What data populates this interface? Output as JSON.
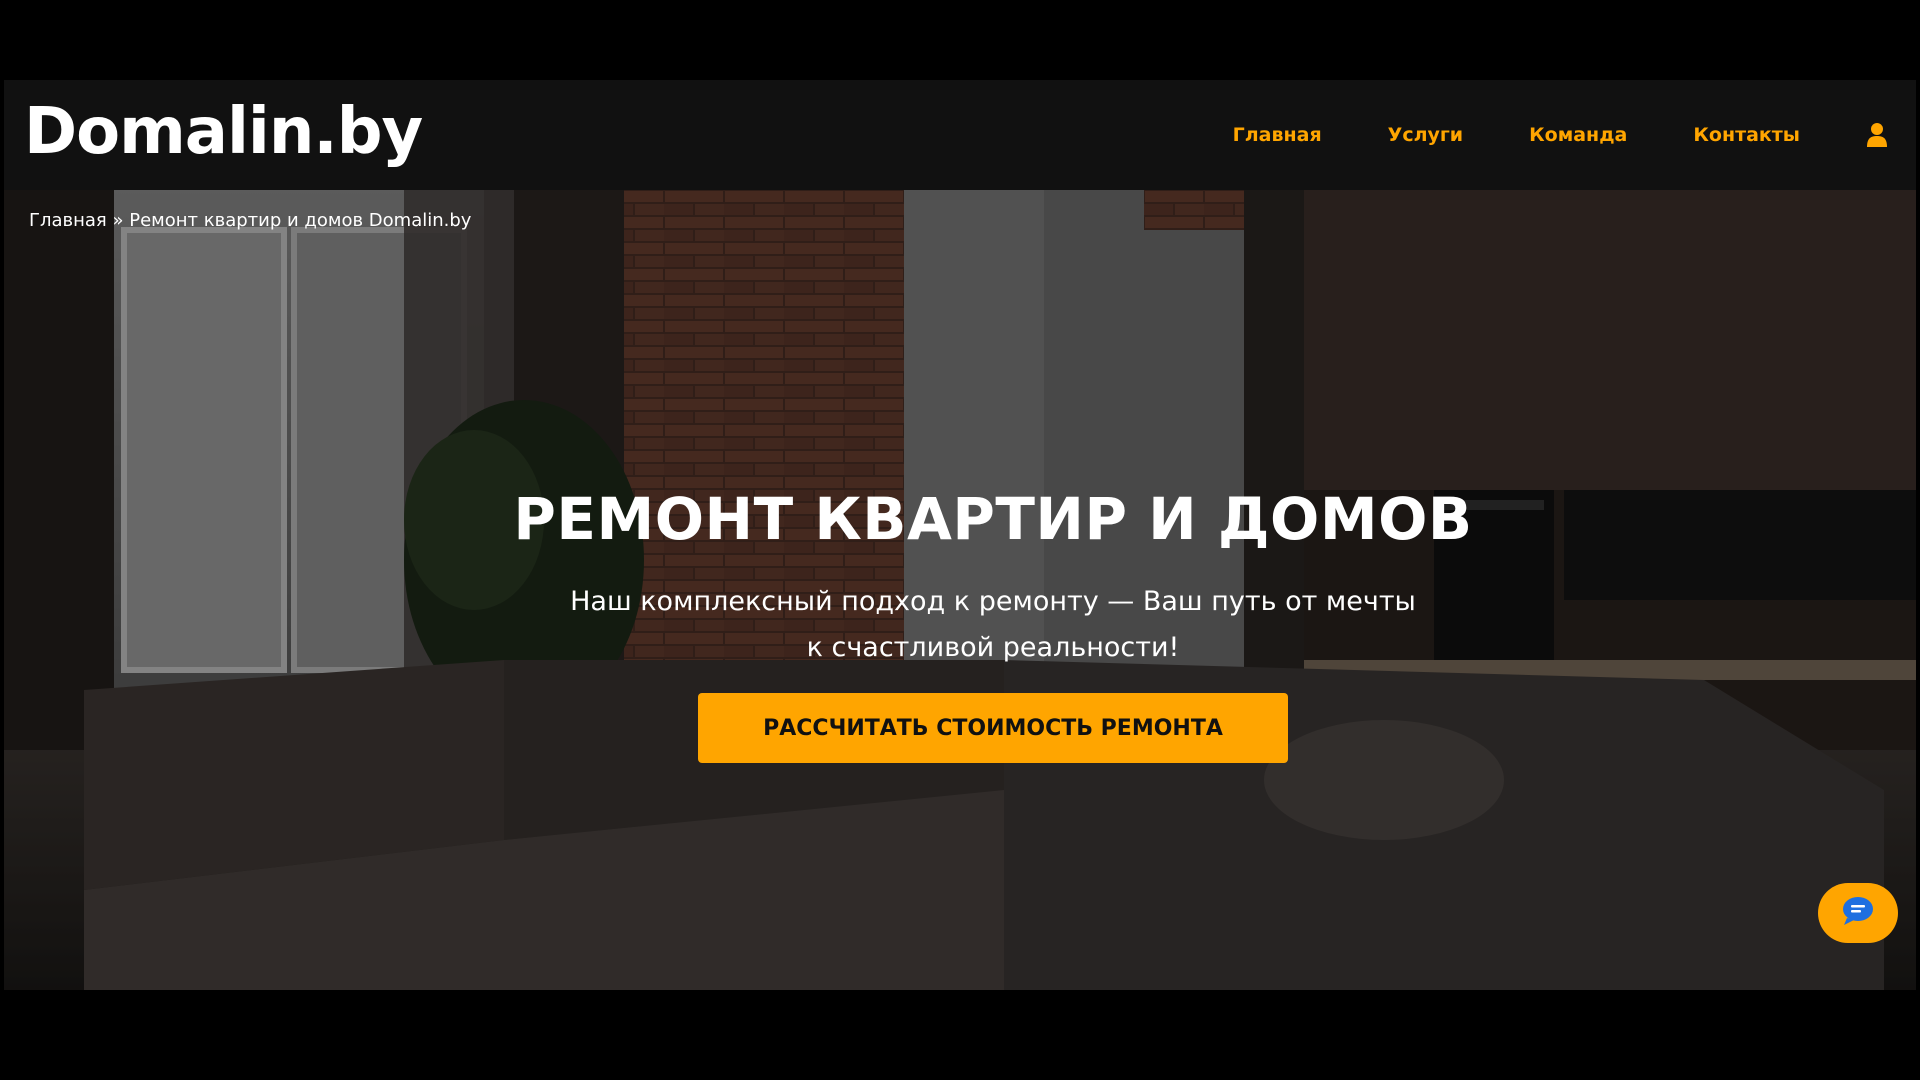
{
  "header": {
    "logo": "Domalin.by",
    "nav": [
      {
        "label": "Главная"
      },
      {
        "label": "Услуги"
      },
      {
        "label": "Команда"
      },
      {
        "label": "Контакты"
      }
    ],
    "user_icon": "user-icon"
  },
  "breadcrumb": {
    "home": "Главная",
    "separator": "»",
    "current": "Ремонт квартир и домов Domalin.by"
  },
  "hero": {
    "title": "РЕМОНТ КВАРТИР И ДОМОВ",
    "subtitle": "Наш комплексный подход к ремонту — Ваш путь от мечты к счастливой реальности!",
    "cta": "РАССЧИТАТЬ СТОИМОСТЬ РЕМОНТА"
  },
  "chat": {
    "icon": "chat-bubble-icon"
  },
  "colors": {
    "accent": "#ffa500",
    "header_bg": "#111111",
    "text": "#ffffff"
  }
}
